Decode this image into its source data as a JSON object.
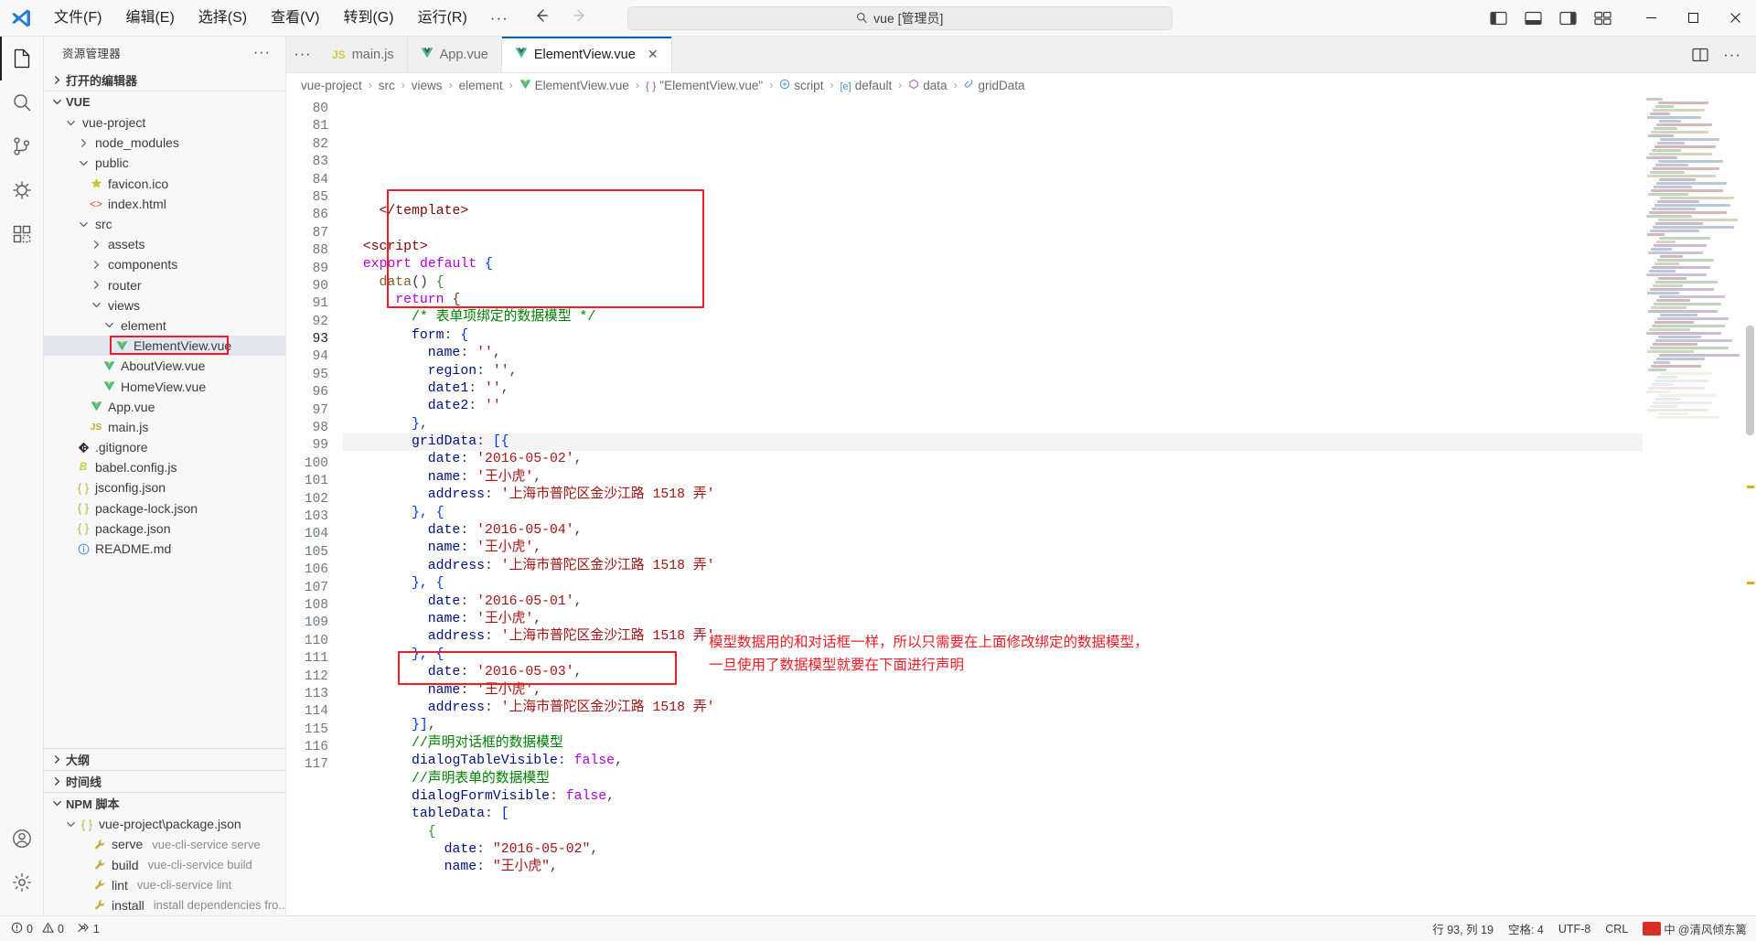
{
  "titlebar": {
    "logo_icon": "vscode-logo",
    "menu": [
      {
        "label": "文件(F)"
      },
      {
        "label": "编辑(E)"
      },
      {
        "label": "选择(S)"
      },
      {
        "label": "查看(V)"
      },
      {
        "label": "转到(G)"
      },
      {
        "label": "运行(R)"
      },
      {
        "label": "···"
      }
    ],
    "nav_back_icon": "arrow-left-icon",
    "nav_forward_icon": "arrow-right-icon",
    "search": {
      "value": "vue [管理员]",
      "icon": "search-icon"
    },
    "layout_icons": [
      "toggle-primary-sidebar-icon",
      "toggle-panel-icon",
      "toggle-secondary-sidebar-icon",
      "customize-layout-icon"
    ],
    "window_buttons": {
      "minimize": "─",
      "maximize": "▢",
      "close": "✕"
    }
  },
  "activitybar": {
    "items": [
      {
        "name": "explorer",
        "icon": "files-icon",
        "active": true
      },
      {
        "name": "search",
        "icon": "search-icon",
        "active": false
      },
      {
        "name": "source-control",
        "icon": "source-control-icon",
        "active": false
      },
      {
        "name": "run-debug",
        "icon": "debug-icon",
        "active": false
      },
      {
        "name": "extensions",
        "icon": "extensions-icon",
        "active": false
      }
    ],
    "bottom": [
      {
        "name": "accounts",
        "icon": "account-icon"
      },
      {
        "name": "settings",
        "icon": "gear-icon"
      }
    ]
  },
  "sidebar": {
    "title": "资源管理器",
    "more_icon": "···",
    "open_editors": {
      "label": "打开的编辑器",
      "expanded": false
    },
    "workspace": {
      "label": "VUE",
      "expanded": true
    },
    "tree": [
      {
        "label": "vue-project",
        "depth": 1,
        "type": "folder",
        "expanded": true
      },
      {
        "label": "node_modules",
        "depth": 2,
        "type": "folder",
        "expanded": false
      },
      {
        "label": "public",
        "depth": 2,
        "type": "folder",
        "expanded": true
      },
      {
        "label": "favicon.ico",
        "depth": 3,
        "type": "ico"
      },
      {
        "label": "index.html",
        "depth": 3,
        "type": "html"
      },
      {
        "label": "src",
        "depth": 2,
        "type": "folder",
        "expanded": true
      },
      {
        "label": "assets",
        "depth": 3,
        "type": "folder",
        "expanded": false
      },
      {
        "label": "components",
        "depth": 3,
        "type": "folder",
        "expanded": false
      },
      {
        "label": "router",
        "depth": 3,
        "type": "folder",
        "expanded": false
      },
      {
        "label": "views",
        "depth": 3,
        "type": "folder",
        "expanded": true
      },
      {
        "label": "element",
        "depth": 4,
        "type": "folder",
        "expanded": true
      },
      {
        "label": "ElementView.vue",
        "depth": 5,
        "type": "vue",
        "selected": true,
        "annotated": true
      },
      {
        "label": "AboutView.vue",
        "depth": 4,
        "type": "vue"
      },
      {
        "label": "HomeView.vue",
        "depth": 4,
        "type": "vue"
      },
      {
        "label": "App.vue",
        "depth": 3,
        "type": "vue"
      },
      {
        "label": "main.js",
        "depth": 3,
        "type": "js"
      },
      {
        "label": ".gitignore",
        "depth": 2,
        "type": "git"
      },
      {
        "label": "babel.config.js",
        "depth": 2,
        "type": "babel"
      },
      {
        "label": "jsconfig.json",
        "depth": 2,
        "type": "json"
      },
      {
        "label": "package-lock.json",
        "depth": 2,
        "type": "json"
      },
      {
        "label": "package.json",
        "depth": 2,
        "type": "json"
      },
      {
        "label": "README.md",
        "depth": 2,
        "type": "md"
      }
    ],
    "sections": [
      {
        "label": "大纲",
        "expanded": false
      },
      {
        "label": "时间线",
        "expanded": false
      }
    ],
    "npm": {
      "label": "NPM 脚本",
      "expanded": true,
      "package": "vue-project\\package.json",
      "scripts": [
        {
          "name": "serve",
          "cmd": "vue-cli-service serve"
        },
        {
          "name": "build",
          "cmd": "vue-cli-service build"
        },
        {
          "name": "lint",
          "cmd": "vue-cli-service lint"
        },
        {
          "name": "install",
          "cmd": "install dependencies fro..."
        }
      ]
    }
  },
  "editor": {
    "tabs_more_icon": "···",
    "tabs": [
      {
        "label": "main.js",
        "type": "js",
        "active": false
      },
      {
        "label": "App.vue",
        "type": "vue",
        "active": false
      },
      {
        "label": "ElementView.vue",
        "type": "vue",
        "active": true,
        "close_icon": "✕"
      }
    ],
    "tabs_right_icons": [
      "split-editor-icon",
      "more-actions-icon"
    ],
    "breadcrumb": [
      {
        "label": "vue-project",
        "icon": ""
      },
      {
        "label": "src",
        "icon": ""
      },
      {
        "label": "views",
        "icon": ""
      },
      {
        "label": "element",
        "icon": ""
      },
      {
        "label": "ElementView.vue",
        "icon": "vue-icon"
      },
      {
        "label": "\"ElementView.vue\"",
        "icon": "braces-icon"
      },
      {
        "label": "script",
        "icon": "tag-icon"
      },
      {
        "label": "default",
        "icon": "property-icon"
      },
      {
        "label": "data",
        "icon": "method-icon"
      },
      {
        "label": "gridData",
        "icon": "field-icon"
      }
    ],
    "first_line_number": 80,
    "lines": [
      {
        "n": 80,
        "tokens": [
          {
            "t": "    ",
            "c": "pun"
          },
          {
            "t": "</template>",
            "c": "tag"
          }
        ]
      },
      {
        "n": 81,
        "tokens": []
      },
      {
        "n": 82,
        "tokens": [
          {
            "t": "  ",
            "c": "pun"
          },
          {
            "t": "<script>",
            "c": "tag"
          }
        ]
      },
      {
        "n": 83,
        "tokens": [
          {
            "t": "  ",
            "c": "pun"
          },
          {
            "t": "export",
            "c": "key"
          },
          {
            "t": " ",
            "c": "pun"
          },
          {
            "t": "default",
            "c": "key"
          },
          {
            "t": " ",
            "c": "pun"
          },
          {
            "t": "{",
            "c": "brk1"
          }
        ]
      },
      {
        "n": 84,
        "tokens": [
          {
            "t": "    ",
            "c": "pun"
          },
          {
            "t": "data",
            "c": "fn"
          },
          {
            "t": "() ",
            "c": "pun"
          },
          {
            "t": "{",
            "c": "brk2"
          }
        ]
      },
      {
        "n": 85,
        "tokens": [
          {
            "t": "      ",
            "c": "pun"
          },
          {
            "t": "return",
            "c": "key"
          },
          {
            "t": " ",
            "c": "pun"
          },
          {
            "t": "{",
            "c": "brk3"
          }
        ]
      },
      {
        "n": 86,
        "tokens": [
          {
            "t": "        ",
            "c": "pun"
          },
          {
            "t": "/* 表单项绑定的数据模型 */",
            "c": "cmt"
          }
        ]
      },
      {
        "n": 87,
        "tokens": [
          {
            "t": "        ",
            "c": "pun"
          },
          {
            "t": "form",
            "c": "var"
          },
          {
            "t": ": ",
            "c": "pun"
          },
          {
            "t": "{",
            "c": "brk1"
          }
        ]
      },
      {
        "n": 88,
        "tokens": [
          {
            "t": "          ",
            "c": "pun"
          },
          {
            "t": "name",
            "c": "var"
          },
          {
            "t": ": ",
            "c": "pun"
          },
          {
            "t": "''",
            "c": "str"
          },
          {
            "t": ",",
            "c": "pun"
          }
        ]
      },
      {
        "n": 89,
        "tokens": [
          {
            "t": "          ",
            "c": "pun"
          },
          {
            "t": "region",
            "c": "var"
          },
          {
            "t": ": ",
            "c": "pun"
          },
          {
            "t": "''",
            "c": "str"
          },
          {
            "t": ",",
            "c": "pun"
          }
        ]
      },
      {
        "n": 90,
        "tokens": [
          {
            "t": "          ",
            "c": "pun"
          },
          {
            "t": "date1",
            "c": "var"
          },
          {
            "t": ": ",
            "c": "pun"
          },
          {
            "t": "''",
            "c": "str"
          },
          {
            "t": ",",
            "c": "pun"
          }
        ]
      },
      {
        "n": 91,
        "tokens": [
          {
            "t": "          ",
            "c": "pun"
          },
          {
            "t": "date2",
            "c": "var"
          },
          {
            "t": ": ",
            "c": "pun"
          },
          {
            "t": "''",
            "c": "str"
          }
        ]
      },
      {
        "n": 92,
        "tokens": [
          {
            "t": "        ",
            "c": "pun"
          },
          {
            "t": "}",
            "c": "brk1"
          },
          {
            "t": ",",
            "c": "pun"
          }
        ]
      },
      {
        "n": 93,
        "tokens": [
          {
            "t": "        ",
            "c": "pun"
          },
          {
            "t": "gridData",
            "c": "var"
          },
          {
            "t": ": ",
            "c": "pun"
          },
          {
            "t": "[{",
            "c": "brk1"
          }
        ]
      },
      {
        "n": 94,
        "tokens": [
          {
            "t": "          ",
            "c": "pun"
          },
          {
            "t": "date",
            "c": "var"
          },
          {
            "t": ": ",
            "c": "pun"
          },
          {
            "t": "'2016-05-02'",
            "c": "str"
          },
          {
            "t": ",",
            "c": "pun"
          }
        ]
      },
      {
        "n": 95,
        "tokens": [
          {
            "t": "          ",
            "c": "pun"
          },
          {
            "t": "name",
            "c": "var"
          },
          {
            "t": ": ",
            "c": "pun"
          },
          {
            "t": "'王小虎'",
            "c": "str"
          },
          {
            "t": ",",
            "c": "pun"
          }
        ]
      },
      {
        "n": 96,
        "tokens": [
          {
            "t": "          ",
            "c": "pun"
          },
          {
            "t": "address",
            "c": "var"
          },
          {
            "t": ": ",
            "c": "pun"
          },
          {
            "t": "'上海市普陀区金沙江路 1518 弄'",
            "c": "str"
          }
        ]
      },
      {
        "n": 97,
        "tokens": [
          {
            "t": "        ",
            "c": "pun"
          },
          {
            "t": "}, {",
            "c": "brk1"
          }
        ]
      },
      {
        "n": 98,
        "tokens": [
          {
            "t": "          ",
            "c": "pun"
          },
          {
            "t": "date",
            "c": "var"
          },
          {
            "t": ": ",
            "c": "pun"
          },
          {
            "t": "'2016-05-04'",
            "c": "str"
          },
          {
            "t": ",",
            "c": "pun"
          }
        ]
      },
      {
        "n": 99,
        "tokens": [
          {
            "t": "          ",
            "c": "pun"
          },
          {
            "t": "name",
            "c": "var"
          },
          {
            "t": ": ",
            "c": "pun"
          },
          {
            "t": "'王小虎'",
            "c": "str"
          },
          {
            "t": ",",
            "c": "pun"
          }
        ]
      },
      {
        "n": 100,
        "tokens": [
          {
            "t": "          ",
            "c": "pun"
          },
          {
            "t": "address",
            "c": "var"
          },
          {
            "t": ": ",
            "c": "pun"
          },
          {
            "t": "'上海市普陀区金沙江路 1518 弄'",
            "c": "str"
          }
        ]
      },
      {
        "n": 101,
        "tokens": [
          {
            "t": "        ",
            "c": "pun"
          },
          {
            "t": "}, {",
            "c": "brk1"
          }
        ]
      },
      {
        "n": 102,
        "tokens": [
          {
            "t": "          ",
            "c": "pun"
          },
          {
            "t": "date",
            "c": "var"
          },
          {
            "t": ": ",
            "c": "pun"
          },
          {
            "t": "'2016-05-01'",
            "c": "str"
          },
          {
            "t": ",",
            "c": "pun"
          }
        ]
      },
      {
        "n": 103,
        "tokens": [
          {
            "t": "          ",
            "c": "pun"
          },
          {
            "t": "name",
            "c": "var"
          },
          {
            "t": ": ",
            "c": "pun"
          },
          {
            "t": "'王小虎'",
            "c": "str"
          },
          {
            "t": ",",
            "c": "pun"
          }
        ]
      },
      {
        "n": 104,
        "tokens": [
          {
            "t": "          ",
            "c": "pun"
          },
          {
            "t": "address",
            "c": "var"
          },
          {
            "t": ": ",
            "c": "pun"
          },
          {
            "t": "'上海市普陀区金沙江路 1518 弄'",
            "c": "str"
          }
        ]
      },
      {
        "n": 105,
        "tokens": [
          {
            "t": "        ",
            "c": "pun"
          },
          {
            "t": "}, {",
            "c": "brk1"
          }
        ]
      },
      {
        "n": 106,
        "tokens": [
          {
            "t": "          ",
            "c": "pun"
          },
          {
            "t": "date",
            "c": "var"
          },
          {
            "t": ": ",
            "c": "pun"
          },
          {
            "t": "'2016-05-03'",
            "c": "str"
          },
          {
            "t": ",",
            "c": "pun"
          }
        ]
      },
      {
        "n": 107,
        "tokens": [
          {
            "t": "          ",
            "c": "pun"
          },
          {
            "t": "name",
            "c": "var"
          },
          {
            "t": ": ",
            "c": "pun"
          },
          {
            "t": "'王小虎'",
            "c": "str"
          },
          {
            "t": ",",
            "c": "pun"
          }
        ]
      },
      {
        "n": 108,
        "tokens": [
          {
            "t": "          ",
            "c": "pun"
          },
          {
            "t": "address",
            "c": "var"
          },
          {
            "t": ": ",
            "c": "pun"
          },
          {
            "t": "'上海市普陀区金沙江路 1518 弄'",
            "c": "str"
          }
        ]
      },
      {
        "n": 109,
        "tokens": [
          {
            "t": "        ",
            "c": "pun"
          },
          {
            "t": "}]",
            "c": "brk1"
          },
          {
            "t": ",",
            "c": "pun"
          }
        ]
      },
      {
        "n": 110,
        "tokens": [
          {
            "t": "        ",
            "c": "pun"
          },
          {
            "t": "//声明对话框的数据模型",
            "c": "cmt"
          }
        ]
      },
      {
        "n": 111,
        "tokens": [
          {
            "t": "        ",
            "c": "pun"
          },
          {
            "t": "dialogTableVisible",
            "c": "var"
          },
          {
            "t": ": ",
            "c": "pun"
          },
          {
            "t": "false",
            "c": "key"
          },
          {
            "t": ",",
            "c": "pun"
          }
        ]
      },
      {
        "n": 112,
        "tokens": [
          {
            "t": "        ",
            "c": "pun"
          },
          {
            "t": "//声明表单的数据模型",
            "c": "cmt"
          }
        ]
      },
      {
        "n": 113,
        "tokens": [
          {
            "t": "        ",
            "c": "pun"
          },
          {
            "t": "dialogFormVisible",
            "c": "var"
          },
          {
            "t": ": ",
            "c": "pun"
          },
          {
            "t": "false",
            "c": "key"
          },
          {
            "t": ",",
            "c": "pun"
          }
        ]
      },
      {
        "n": 114,
        "tokens": [
          {
            "t": "        ",
            "c": "pun"
          },
          {
            "t": "tableData",
            "c": "var"
          },
          {
            "t": ": ",
            "c": "pun"
          },
          {
            "t": "[",
            "c": "brk1"
          }
        ]
      },
      {
        "n": 115,
        "tokens": [
          {
            "t": "          ",
            "c": "pun"
          },
          {
            "t": "{",
            "c": "brk2"
          }
        ]
      },
      {
        "n": 116,
        "tokens": [
          {
            "t": "            ",
            "c": "pun"
          },
          {
            "t": "date",
            "c": "var"
          },
          {
            "t": ": ",
            "c": "pun"
          },
          {
            "t": "\"2016-05-02\"",
            "c": "str"
          },
          {
            "t": ",",
            "c": "pun"
          }
        ]
      },
      {
        "n": 117,
        "tokens": [
          {
            "t": "            ",
            "c": "pun"
          },
          {
            "t": "name",
            "c": "var"
          },
          {
            "t": ": ",
            "c": "pun"
          },
          {
            "t": "\"王小虎\"",
            "c": "str"
          },
          {
            "t": ",",
            "c": "pun"
          }
        ]
      }
    ],
    "annotations": {
      "note_line1": "模型数据用的和对话框一样，所以只需要在上面修改绑定的数据模型，",
      "note_line2": "一旦使用了数据模型就要在下面进行声明"
    }
  },
  "statusbar": {
    "errors_icon": "error-icon",
    "errors": "0",
    "warnings_icon": "warning-icon",
    "warnings": "0",
    "ports_icon": "ports-icon",
    "ports": "1",
    "cursor": "行 93, 列 19",
    "indent": "空格: 4",
    "encoding": "UTF-8",
    "eol": "CRL",
    "ime": "中",
    "watermark": "@清风倾东篱"
  }
}
